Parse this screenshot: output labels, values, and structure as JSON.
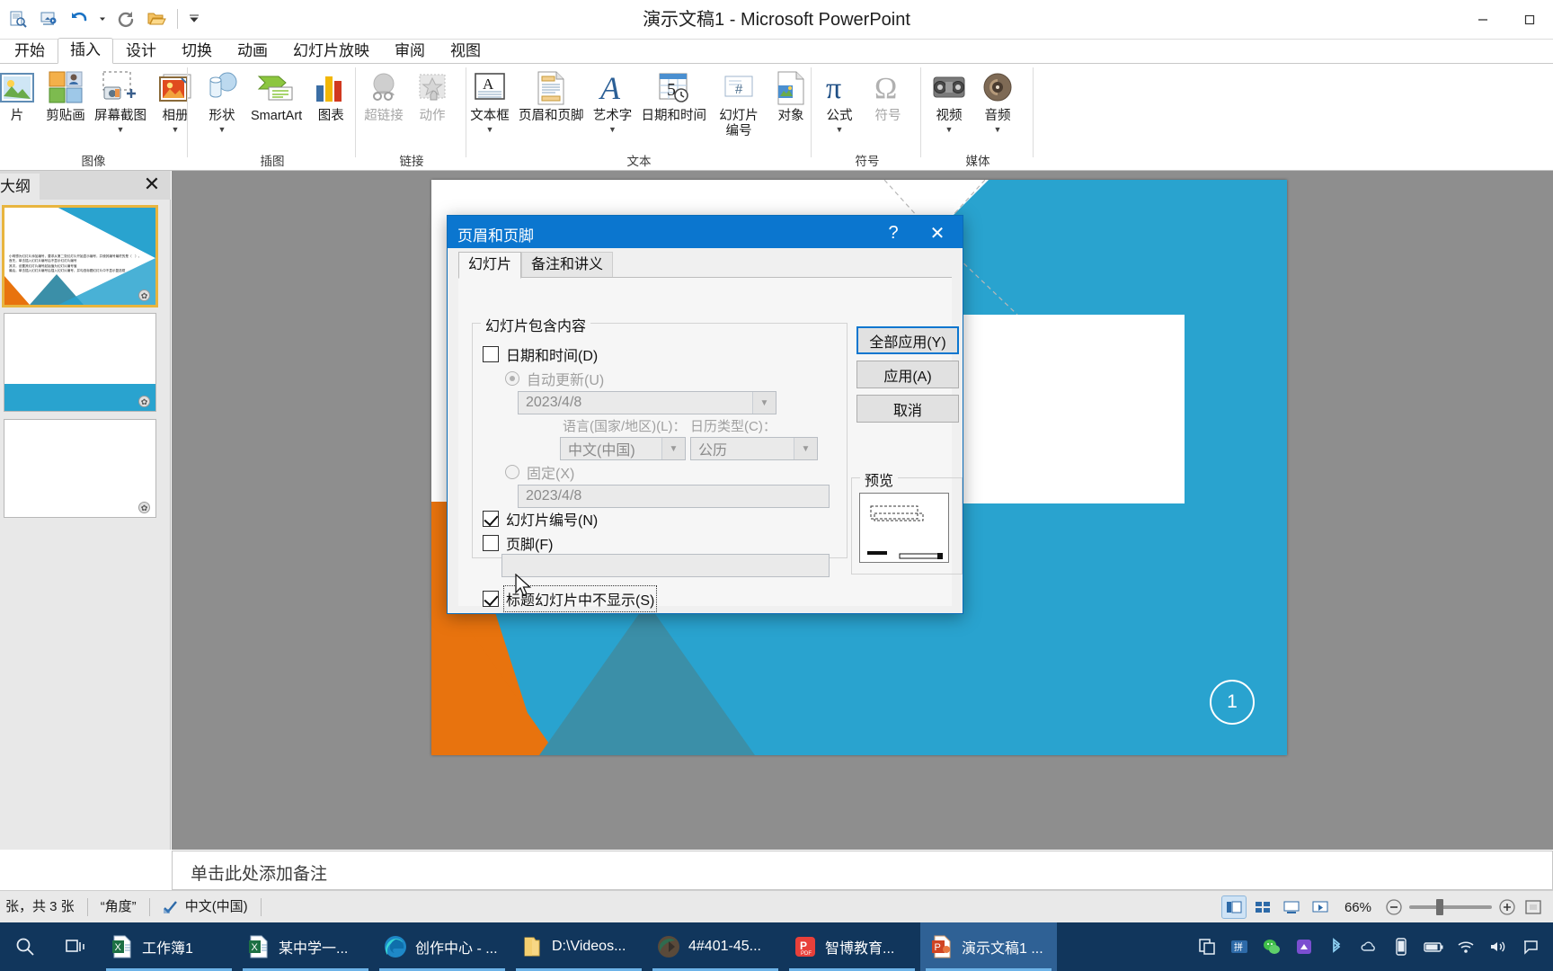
{
  "window": {
    "title": "演示文稿1 - Microsoft PowerPoint",
    "minimize": "–",
    "maximize": "▢",
    "close": "✕"
  },
  "quick_access": {
    "items": [
      {
        "name": "print-preview-icon",
        "tip": "打印预览"
      },
      {
        "name": "slideshow-icon",
        "tip": "从头开始放映"
      },
      {
        "name": "undo-icon",
        "tip": "撤消"
      },
      {
        "name": "undo-dropdown-icon",
        "tip": "撤消下拉"
      },
      {
        "name": "redo-icon",
        "tip": "重复"
      },
      {
        "name": "open-icon",
        "tip": "打开"
      },
      {
        "name": "customize-qat-icon",
        "tip": "自定义快速访问工具栏"
      }
    ]
  },
  "ribbon": {
    "tabs": [
      {
        "label": "开始",
        "active": false
      },
      {
        "label": "插入",
        "active": true
      },
      {
        "label": "设计",
        "active": false
      },
      {
        "label": "切换",
        "active": false
      },
      {
        "label": "动画",
        "active": false
      },
      {
        "label": "幻灯片放映",
        "active": false
      },
      {
        "label": "审阅",
        "active": false
      },
      {
        "label": "视图",
        "active": false
      }
    ],
    "groups": [
      {
        "name": "images",
        "label": "图像",
        "items": [
          {
            "label": "片",
            "icon": "picture-icon",
            "carat": false,
            "disabled": false
          },
          {
            "label": "剪贴画",
            "icon": "clipart-icon",
            "carat": false,
            "disabled": false
          },
          {
            "label": "屏幕截图",
            "icon": "screenshot-icon",
            "carat": true,
            "disabled": false
          },
          {
            "label": "相册",
            "icon": "photo-album-icon",
            "carat": true,
            "disabled": false
          }
        ]
      },
      {
        "name": "illustrations",
        "label": "插图",
        "items": [
          {
            "label": "形状",
            "icon": "shapes-icon",
            "carat": true,
            "disabled": false
          },
          {
            "label": "SmartArt",
            "icon": "smartart-icon",
            "carat": false,
            "disabled": false
          },
          {
            "label": "图表",
            "icon": "chart-icon",
            "carat": false,
            "disabled": false
          }
        ]
      },
      {
        "name": "links",
        "label": "链接",
        "items": [
          {
            "label": "超链接",
            "icon": "hyperlink-icon",
            "carat": false,
            "disabled": true
          },
          {
            "label": "动作",
            "icon": "action-icon",
            "carat": false,
            "disabled": true
          }
        ]
      },
      {
        "name": "text",
        "label": "文本",
        "items": [
          {
            "label": "文本框",
            "icon": "textbox-icon",
            "carat": true,
            "disabled": false
          },
          {
            "label": "页眉和页脚",
            "icon": "header-footer-icon",
            "carat": false,
            "disabled": false
          },
          {
            "label": "艺术字",
            "icon": "wordart-icon",
            "carat": true,
            "disabled": false
          },
          {
            "label": "日期和时间",
            "icon": "date-time-icon",
            "carat": false,
            "disabled": false
          },
          {
            "label": "幻灯片编号",
            "icon": "slide-number-icon",
            "carat": false,
            "disabled": false
          },
          {
            "label": "对象",
            "icon": "object-icon",
            "carat": false,
            "disabled": false
          }
        ]
      },
      {
        "name": "symbols",
        "label": "符号",
        "items": [
          {
            "label": "公式",
            "icon": "equation-icon",
            "carat": true,
            "disabled": false
          },
          {
            "label": "符号",
            "icon": "symbol-icon",
            "carat": false,
            "disabled": true
          }
        ]
      },
      {
        "name": "media",
        "label": "媒体",
        "items": [
          {
            "label": "视频",
            "icon": "video-icon",
            "carat": true,
            "disabled": false
          },
          {
            "label": "音频",
            "icon": "audio-icon",
            "carat": true,
            "disabled": false
          }
        ]
      }
    ]
  },
  "outline_pane": {
    "tab_label": "大纲",
    "close_label": "✕",
    "slides": [
      {
        "badge": "✿",
        "selected": true
      },
      {
        "badge": "✿",
        "selected": false
      },
      {
        "badge": "✿",
        "selected": false
      }
    ]
  },
  "slide": {
    "number": "1",
    "lines": [
      "开始显示编号，并使其编号",
      "片编号值",
      "后插入幻灯片编号，并勾选",
      "后插入幻灯片编号"
    ]
  },
  "notes": {
    "placeholder": "单击此处添加备注"
  },
  "statusbar": {
    "slide_count": "张，共 3 张",
    "theme": "“角度”",
    "language": "中文(中国)",
    "zoom": "66%",
    "zoom_out": "−",
    "zoom_in": "+",
    "views": [
      {
        "name": "normal-view-button",
        "active": true
      },
      {
        "name": "slide-sorter-view-button",
        "active": false
      },
      {
        "name": "reading-view-button",
        "active": false
      },
      {
        "name": "slideshow-view-button",
        "active": false
      }
    ]
  },
  "dialog": {
    "title": "页眉和页脚",
    "help_label": "?",
    "close_label": "✕",
    "tabs": [
      {
        "label": "幻灯片",
        "active": true
      },
      {
        "label": "备注和讲义",
        "active": false
      }
    ],
    "group_title": "幻灯片包含内容",
    "date_time": {
      "label": "日期和时间(D)",
      "accel": "D",
      "checked": false
    },
    "auto_update": {
      "label": "自动更新(U)",
      "accel": "U",
      "selected": true,
      "value": "2023/4/8"
    },
    "language_label": "语言(国家/地区)(L)：",
    "language_value": "中文(中国)",
    "calendar_label": "日历类型(C)：",
    "calendar_value": "公历",
    "fixed": {
      "label": "固定(X)",
      "accel": "X",
      "selected": false,
      "value": "2023/4/8"
    },
    "slide_number": {
      "label": "幻灯片编号(N)",
      "accel": "N",
      "checked": true
    },
    "footer": {
      "label": "页脚(F)",
      "accel": "F",
      "checked": false,
      "value": ""
    },
    "hide_on_title": {
      "label": "标题幻灯片中不显示(S)",
      "accel": "S",
      "checked": true,
      "focused": true
    },
    "buttons": [
      {
        "label": "全部应用(Y)",
        "name": "apply-to-all-button",
        "default": true
      },
      {
        "label": "应用(A)",
        "name": "apply-button",
        "default": false
      },
      {
        "label": "取消",
        "name": "cancel-button",
        "default": false
      }
    ],
    "preview_title": "预览"
  },
  "taskbar": {
    "system": [
      {
        "name": "search-icon"
      },
      {
        "name": "task-view-icon"
      }
    ],
    "apps": [
      {
        "label": "工作簿1",
        "icon": "excel-icon",
        "active": false
      },
      {
        "label": "某中学一...",
        "icon": "excel-icon",
        "active": false
      },
      {
        "label": "创作中心 - ...",
        "icon": "edge-icon",
        "active": false
      },
      {
        "label": "D:\\Videos...",
        "icon": "folder-icon",
        "active": false
      },
      {
        "label": "4#401-45...",
        "icon": "media-icon",
        "active": false
      },
      {
        "label": "智博教育...",
        "icon": "pdf-icon",
        "active": false
      },
      {
        "label": "演示文稿1 ...",
        "icon": "powerpoint-icon",
        "active": true
      }
    ],
    "tray": [
      {
        "name": "copy-icon"
      },
      {
        "name": "input-method-icon"
      },
      {
        "name": "wechat-icon"
      },
      {
        "name": "app-icon"
      },
      {
        "name": "bluetooth-icon"
      },
      {
        "name": "cloud-icon"
      },
      {
        "name": "phone-icon"
      },
      {
        "name": "battery-icon"
      },
      {
        "name": "wifi-icon"
      },
      {
        "name": "volume-icon"
      },
      {
        "name": "notification-icon"
      }
    ]
  },
  "colors": {
    "accent_blue": "#0b76cf",
    "slide_teal": "#29a3cf",
    "slide_orange": "#e8730e",
    "taskbar": "#11365c"
  }
}
